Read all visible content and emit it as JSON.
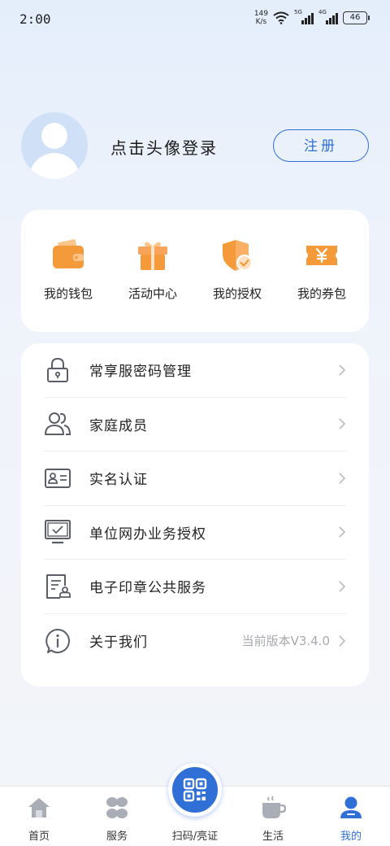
{
  "status_bar": {
    "time": "2:00",
    "net_speed_value": "149",
    "net_speed_unit": "K/s",
    "signal1_label": "5G",
    "signal2_label": "4G",
    "battery": "46"
  },
  "profile": {
    "login_text": "点击头像登录",
    "register_label": "注册"
  },
  "quick_actions": [
    {
      "label": "我的钱包",
      "icon": "wallet-icon"
    },
    {
      "label": "活动中心",
      "icon": "gift-icon"
    },
    {
      "label": "我的授权",
      "icon": "shield-check-icon"
    },
    {
      "label": "我的券包",
      "icon": "coupon-icon"
    }
  ],
  "menu": [
    {
      "label": "常享服密码管理",
      "icon": "lock-icon",
      "value": ""
    },
    {
      "label": "家庭成员",
      "icon": "family-icon",
      "value": ""
    },
    {
      "label": "实名认证",
      "icon": "id-card-icon",
      "value": ""
    },
    {
      "label": "单位网办业务授权",
      "icon": "monitor-icon",
      "value": ""
    },
    {
      "label": "电子印章公共服务",
      "icon": "seal-document-icon",
      "value": ""
    },
    {
      "label": "关于我们",
      "icon": "info-icon",
      "value": "当前版本V3.4.0"
    }
  ],
  "bottom_nav": {
    "items": [
      {
        "label": "首页",
        "icon": "home-icon"
      },
      {
        "label": "服务",
        "icon": "services-icon"
      },
      {
        "label": "扫码/亮证",
        "icon": "qr-scan-icon"
      },
      {
        "label": "生活",
        "icon": "coffee-cup-icon"
      },
      {
        "label": "我的",
        "icon": "user-icon"
      }
    ],
    "active_index": 4
  },
  "colors": {
    "accent": "#2f6fd6",
    "orange": "#f59a3a",
    "icon_gray": "#5a5e66",
    "nav_gray": "#a9adb5"
  }
}
